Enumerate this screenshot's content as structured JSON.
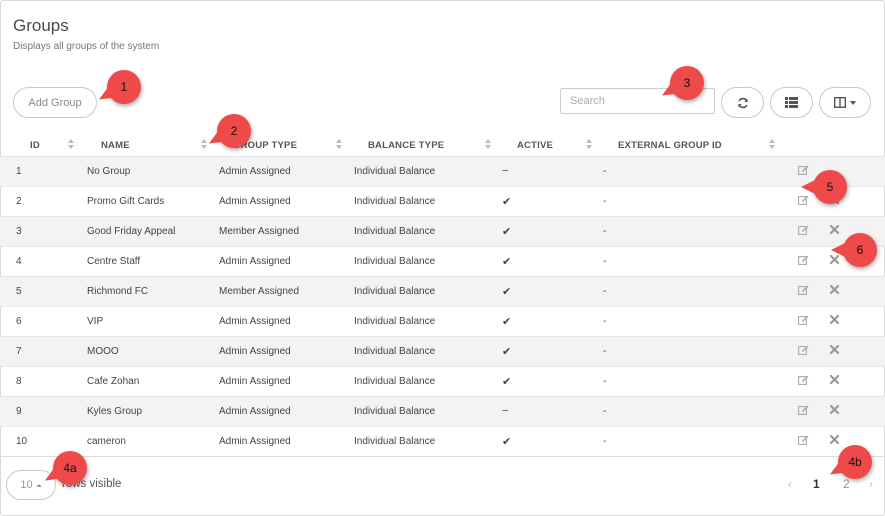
{
  "page": {
    "title": "Groups",
    "subtitle": "Displays all groups of the system"
  },
  "toolbar": {
    "add_label": "Add Group",
    "search_placeholder": "Search",
    "refresh_icon": "refresh-icon",
    "list_icon": "list-icon",
    "columns_icon": "columns-icon"
  },
  "table": {
    "columns": [
      "ID",
      "NAME",
      "GROUP TYPE",
      "BALANCE TYPE",
      "ACTIVE",
      "EXTERNAL GROUP ID"
    ],
    "rows": [
      {
        "id": "1",
        "name": "No Group",
        "group_type": "Admin Assigned",
        "balance_type": "Individual Balance",
        "active": "−",
        "external_id": "-",
        "delete": false
      },
      {
        "id": "2",
        "name": "Promo Gift Cards",
        "group_type": "Admin Assigned",
        "balance_type": "Individual Balance",
        "active": "✔",
        "external_id": "-",
        "delete": true
      },
      {
        "id": "3",
        "name": "Good Friday Appeal",
        "group_type": "Member Assigned",
        "balance_type": "Individual Balance",
        "active": "✔",
        "external_id": "-",
        "delete": true
      },
      {
        "id": "4",
        "name": "Centre Staff",
        "group_type": "Admin Assigned",
        "balance_type": "Individual Balance",
        "active": "✔",
        "external_id": "-",
        "delete": true
      },
      {
        "id": "5",
        "name": "Richmond FC",
        "group_type": "Member Assigned",
        "balance_type": "Individual Balance",
        "active": "✔",
        "external_id": "-",
        "delete": true
      },
      {
        "id": "6",
        "name": "VIP",
        "group_type": "Admin Assigned",
        "balance_type": "Individual Balance",
        "active": "✔",
        "external_id": "-",
        "delete": true
      },
      {
        "id": "7",
        "name": "MOOO",
        "group_type": "Admin Assigned",
        "balance_type": "Individual Balance",
        "active": "✔",
        "external_id": "-",
        "delete": true
      },
      {
        "id": "8",
        "name": "Cafe Zohan",
        "group_type": "Admin Assigned",
        "balance_type": "Individual Balance",
        "active": "✔",
        "external_id": "-",
        "delete": true
      },
      {
        "id": "9",
        "name": "Kyles Group",
        "group_type": "Admin Assigned",
        "balance_type": "Individual Balance",
        "active": "−",
        "external_id": "-",
        "delete": true
      },
      {
        "id": "10",
        "name": "cameron",
        "group_type": "Admin Assigned",
        "balance_type": "Individual Balance",
        "active": "✔",
        "external_id": "-",
        "delete": true
      }
    ]
  },
  "footer": {
    "page_size": "10",
    "rows_visible_label": "rows visible",
    "prev": "‹",
    "pages": [
      "1",
      "2"
    ],
    "next": "›",
    "current_page": "1"
  },
  "callouts": [
    "1",
    "2",
    "3",
    "4a",
    "4b",
    "5",
    "6"
  ],
  "colors": {
    "callout": "#ef4a4a",
    "stripe": "#f3f3f3",
    "border": "#c8c8c8"
  }
}
